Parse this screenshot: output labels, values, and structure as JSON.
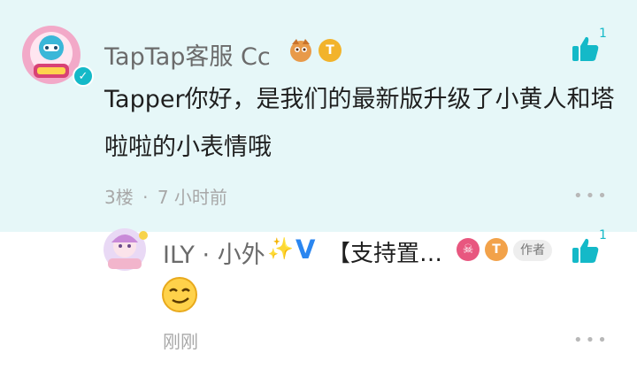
{
  "comment": {
    "username": "TapTap客服 Cc",
    "text": "Tapper你好，是我们的最新版升级了小黄人和塔啦啦的小表情哦",
    "floor": "3楼",
    "dot": "·",
    "time": "7 小时前",
    "like_count": "1",
    "level_badge": "T",
    "verified_mark": "✓",
    "more_glyph": "•••",
    "accent": "#14b9c8"
  },
  "reply": {
    "username": "ILY · 小外",
    "sparkle": "✨",
    "v_mark": "V",
    "signature": "【支持置…",
    "badge_shield": "☠",
    "level_badge": "T",
    "author_tag": "作者",
    "emoji": "😏",
    "time": "刚刚",
    "like_count": "1",
    "more_glyph": "•••"
  },
  "icons": [
    "avatar-cc",
    "verified-icon",
    "mascot-badge-icon",
    "level-badge-icon",
    "thumbs-up-icon",
    "more-icon",
    "avatar-ily",
    "sparkle-icon",
    "v-icon",
    "emoji-icon"
  ]
}
